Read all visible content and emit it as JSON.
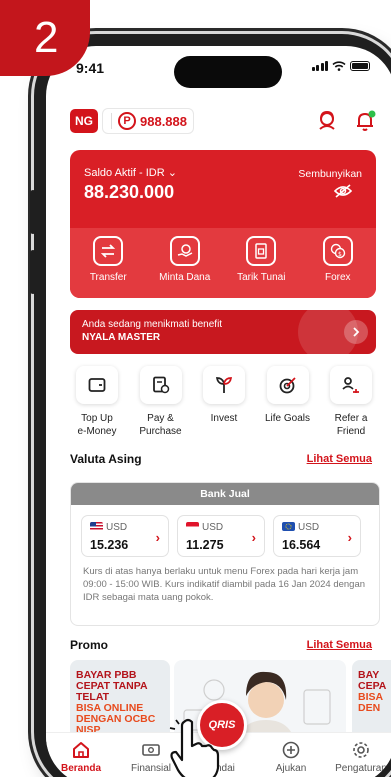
{
  "step_badge": "2",
  "status_bar": {
    "time": "9:41"
  },
  "header": {
    "account_badge": "NG",
    "points_symbol": "P",
    "points": "988.888"
  },
  "saldo": {
    "label": "Saldo Aktif - IDR",
    "value": "88.230.000",
    "hide_label": "Sembunyikan"
  },
  "card_actions": [
    {
      "label": "Transfer",
      "icon": "transfer-icon"
    },
    {
      "label": "Minta Dana",
      "icon": "request-money-icon"
    },
    {
      "label": "Tarik Tunai",
      "icon": "cash-withdrawal-icon"
    },
    {
      "label": "Forex",
      "icon": "forex-icon"
    }
  ],
  "benefit": {
    "line1": "Anda sedang menikmati benefit",
    "line2": "NYALA MASTER"
  },
  "menu": [
    {
      "label": "Top Up\ne-Money",
      "icon": "wallet-icon"
    },
    {
      "label": "Pay &\nPurchase",
      "icon": "bill-icon"
    },
    {
      "label": "Invest",
      "icon": "plant-icon"
    },
    {
      "label": "Life Goals",
      "icon": "target-icon"
    },
    {
      "label": "Refer a\nFriend",
      "icon": "refer-friend-icon"
    }
  ],
  "valuta": {
    "title": "Valuta Asing",
    "link": "Lihat Semua",
    "tab": "Bank Jual",
    "rates": [
      {
        "code": "USD",
        "value": "15.236",
        "flag": "us-flag"
      },
      {
        "code": "USD",
        "value": "11.275",
        "flag": "sg-flag"
      },
      {
        "code": "USD",
        "value": "16.564",
        "flag": "eu-flag"
      }
    ],
    "note": "Kurs di atas hanya berlaku untuk menu Forex pada hari kerja jam 09:00 - 15:00 WIB. Kurs indikatif diambil pada 16 Jan 2024 dengan IDR sebagai mata uang pokok."
  },
  "promo": {
    "title": "Promo",
    "link": "Lihat Semua",
    "card1_lines": [
      "BAYAR PBB",
      "CEPAT TANPA TELAT",
      "BISA ONLINE",
      "DENGAN OCBC NISP"
    ],
    "card3_lines": [
      "BAY",
      "CEPA",
      "BISA",
      "DEN"
    ]
  },
  "qris_label": "QRIS",
  "tabs": [
    {
      "label": "Beranda",
      "icon": "home-icon",
      "active": true
    },
    {
      "label": "Finansial",
      "icon": "money-icon",
      "active": false
    },
    {
      "label": "Pindai",
      "icon": "scan-icon",
      "active": false
    },
    {
      "label": "Ajukan",
      "icon": "plus-circle-icon",
      "active": false
    },
    {
      "label": "Pengaturan",
      "icon": "settings-icon",
      "active": false
    }
  ],
  "colors": {
    "brand_red": "#d91f26",
    "accent_red": "#d3141b"
  }
}
